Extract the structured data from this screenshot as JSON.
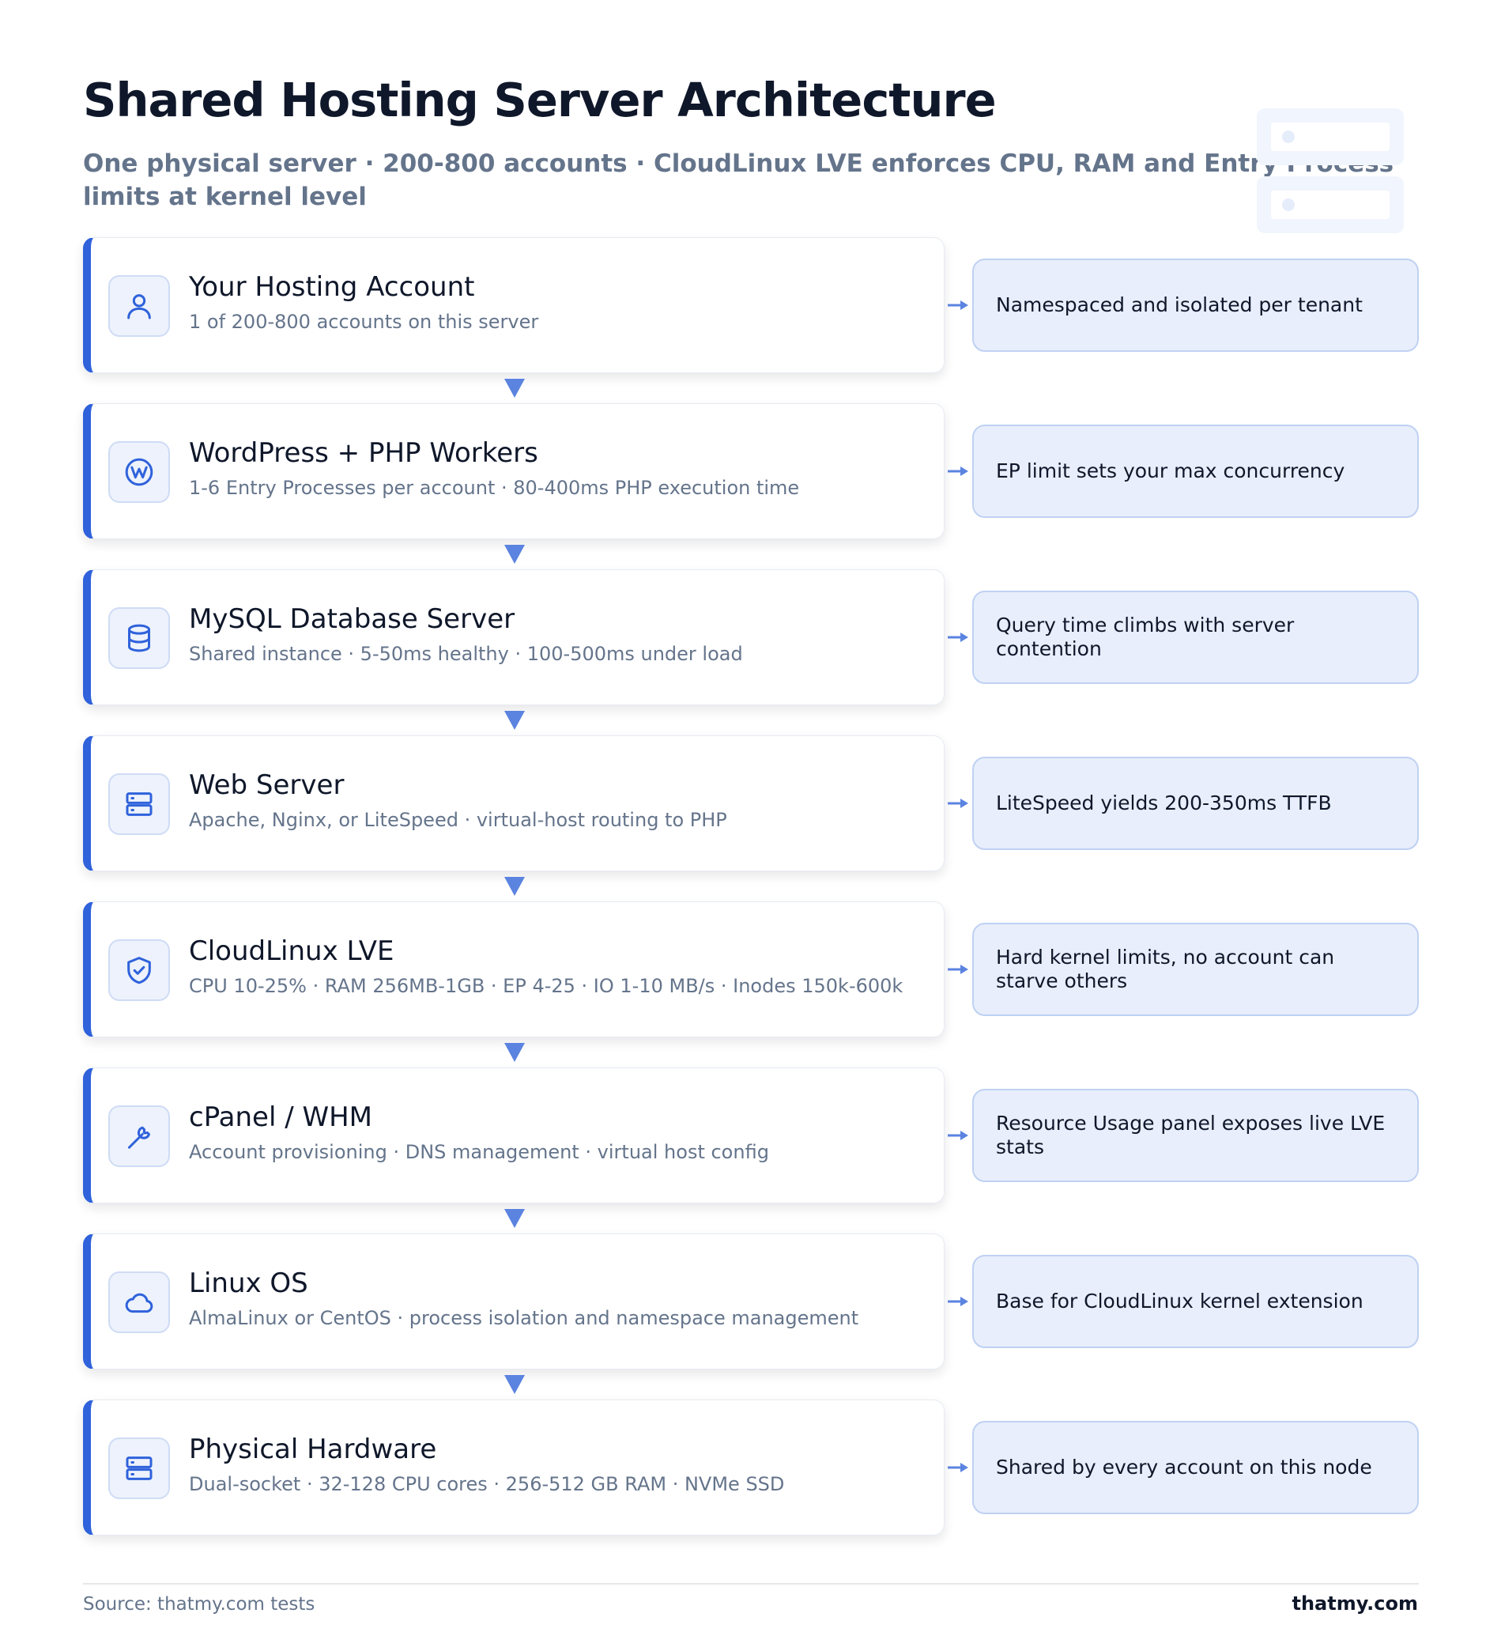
{
  "title": "Shared Hosting Server Architecture",
  "subtitle": "One physical server · 200-800 accounts · CloudLinux LVE enforces CPU, RAM and Entry Process limits at kernel level",
  "colors": {
    "accent": "#2f62db",
    "note_bg": "#e8eefb",
    "note_border": "#bfd1f3",
    "arrow": "#5b83e0"
  },
  "layers": [
    {
      "icon": "user-icon",
      "title": "Your Hosting Account",
      "description": "1 of 200-800 accounts on this server",
      "note": "Namespaced and isolated per tenant"
    },
    {
      "icon": "wordpress-icon",
      "title": "WordPress + PHP Workers",
      "description": "1-6 Entry Processes per account · 80-400ms PHP execution time",
      "note": "EP limit sets your max concurrency"
    },
    {
      "icon": "database-icon",
      "title": "MySQL Database Server",
      "description": "Shared instance · 5-50ms healthy · 100-500ms under load",
      "note": "Query time climbs with server contention"
    },
    {
      "icon": "server-icon",
      "title": "Web Server",
      "description": "Apache, Nginx, or LiteSpeed · virtual-host routing to PHP",
      "note": "LiteSpeed yields 200-350ms TTFB"
    },
    {
      "icon": "shield-check-icon",
      "title": "CloudLinux LVE",
      "description": "CPU 10-25% · RAM 256MB-1GB · EP 4-25 · IO 1-10 MB/s · Inodes 150k-600k",
      "note": "Hard kernel limits, no account can starve others"
    },
    {
      "icon": "wrench-icon",
      "title": "cPanel / WHM",
      "description": "Account provisioning · DNS management · virtual host config",
      "note": "Resource Usage panel exposes live LVE stats"
    },
    {
      "icon": "cloud-icon",
      "title": "Linux OS",
      "description": "AlmaLinux or CentOS · process isolation and namespace management",
      "note": "Base for CloudLinux kernel extension"
    },
    {
      "icon": "server-icon",
      "title": "Physical Hardware",
      "description": "Dual-socket · 32-128 CPU cores · 256-512 GB RAM · NVMe SSD",
      "note": "Shared by every account on this node"
    }
  ],
  "footer": {
    "source": "Source: thatmy.com tests",
    "brand": "thatmy.com"
  }
}
